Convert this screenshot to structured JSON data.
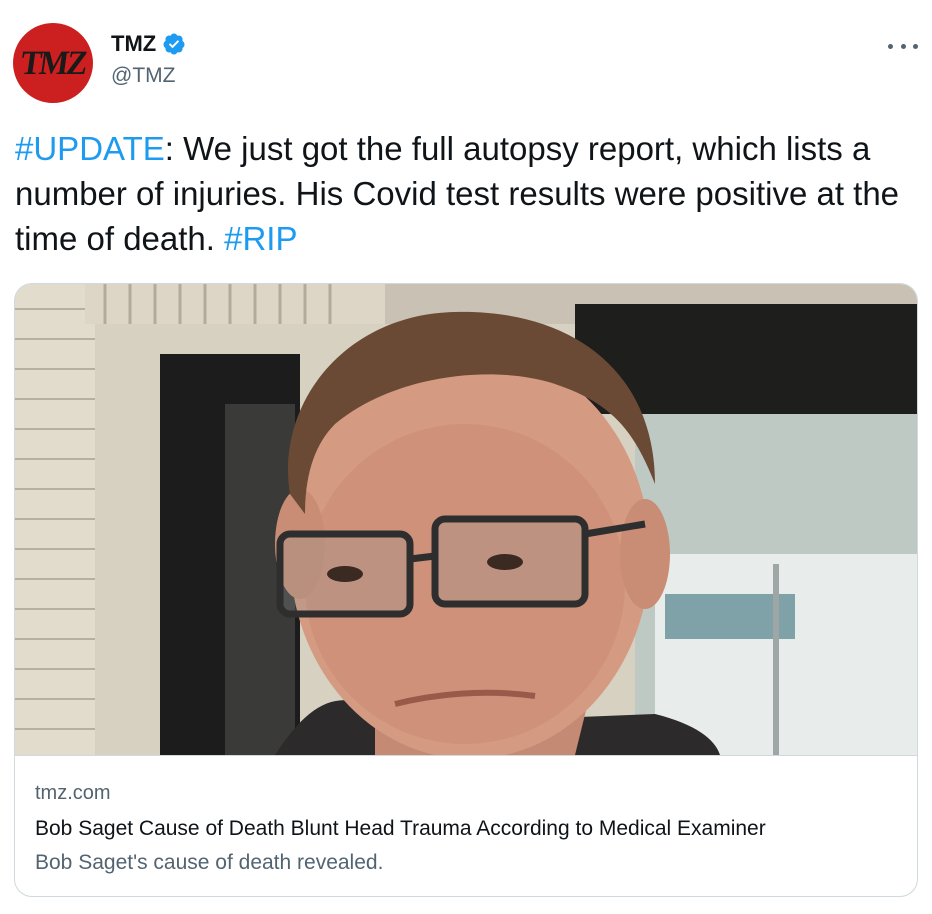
{
  "author": {
    "avatar_text": "TMZ",
    "display_name": "TMZ",
    "handle": "@TMZ",
    "verified": true,
    "verified_icon": "verified-badge-icon",
    "avatar_color": "#cc1f1f"
  },
  "menu": {
    "icon": "more-options-icon"
  },
  "tweet": {
    "hashtag_update": "#UPDATE",
    "body": ": We just got the full autopsy report, which lists a number of injuries. His Covid test results were positive at the time of death. ",
    "hashtag_rip": "#RIP",
    "link_color": "#1d9bf0"
  },
  "card": {
    "image": "photo of a man with glasses and brown hair",
    "domain": "tmz.com",
    "title": "Bob Saget Cause of Death Blunt Head Trauma According to Medical Examiner",
    "description": "Bob Saget's cause of death revealed."
  }
}
